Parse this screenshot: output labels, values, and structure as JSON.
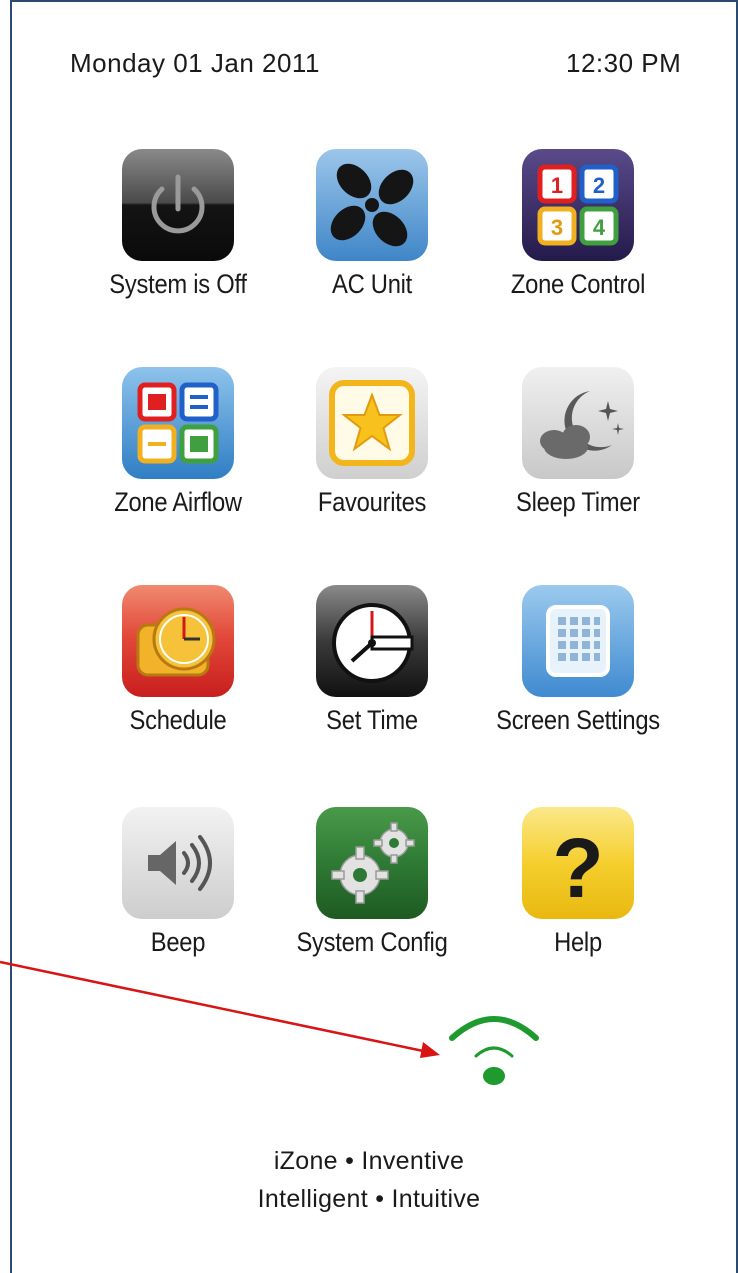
{
  "header": {
    "date": "Monday 01 Jan 2011",
    "time": "12:30 PM"
  },
  "tiles": [
    {
      "label": "System is Off",
      "icon": "power-icon"
    },
    {
      "label": "AC Unit",
      "icon": "fan-icon"
    },
    {
      "label": "Zone Control",
      "icon": "zone-grid-icon"
    },
    {
      "label": "Zone Airflow",
      "icon": "airflow-grid-icon"
    },
    {
      "label": "Favourites",
      "icon": "star-icon"
    },
    {
      "label": "Sleep Timer",
      "icon": "moon-cloud-icon"
    },
    {
      "label": "Schedule",
      "icon": "schedule-clock-icon"
    },
    {
      "label": "Set Time",
      "icon": "clock-icon"
    },
    {
      "label": "Screen Settings",
      "icon": "screen-grid-icon"
    },
    {
      "label": "Beep",
      "icon": "speaker-icon"
    },
    {
      "label": "System Config",
      "icon": "gears-icon"
    },
    {
      "label": "Help",
      "icon": "question-icon"
    }
  ],
  "zone_numbers": [
    "1",
    "2",
    "3",
    "4"
  ],
  "help_glyph": "?",
  "footer": {
    "line1": "iZone • Inventive",
    "line2": "Intelligent • Intuitive"
  },
  "colors": {
    "frame": "#2b4a6f",
    "wifi": "#1e9a2e",
    "arrow": "#d81414"
  }
}
